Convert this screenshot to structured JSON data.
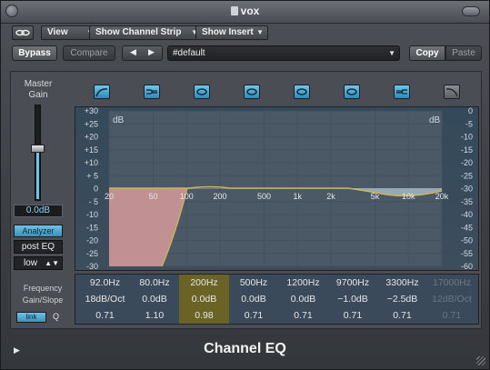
{
  "window": {
    "title": "vox"
  },
  "toolbar": {
    "view_label": "View",
    "channel_strip_label": "Show Channel Strip",
    "insert_label": "Show Insert"
  },
  "preset_bar": {
    "bypass": "Bypass",
    "compare": "Compare",
    "prev": "◀",
    "next": "▶",
    "preset_name": "#default",
    "copy": "Copy",
    "paste": "Paste"
  },
  "master": {
    "label_line1": "Master",
    "label_line2": "Gain",
    "gain_value": "0.0dB",
    "gain_level": 0.54,
    "analyzer": "Analyzer",
    "post_eq": "post EQ",
    "resolution": "low"
  },
  "bands": {
    "icons": [
      {
        "name": "low-cut",
        "active": true
      },
      {
        "name": "low-shelf",
        "active": true
      },
      {
        "name": "bell",
        "active": true
      },
      {
        "name": "bell",
        "active": true
      },
      {
        "name": "bell",
        "active": true
      },
      {
        "name": "bell",
        "active": true
      },
      {
        "name": "high-shelf",
        "active": true
      },
      {
        "name": "high-cut",
        "active": false
      }
    ]
  },
  "graph": {
    "left_unit": "dB",
    "right_unit": "dB",
    "left_scale": [
      "+30",
      "+25",
      "+20",
      "+15",
      "+10",
      "+ 5",
      "0",
      "- 5",
      "-10",
      "-15",
      "-20",
      "-25",
      "-30"
    ],
    "right_scale": [
      "0",
      "-5",
      "-10",
      "-15",
      "-20",
      "-25",
      "-30",
      "-35",
      "-40",
      "-45",
      "-50",
      "-55",
      "-60"
    ],
    "freq_labels": [
      "20",
      "50",
      "100",
      "200",
      "500",
      "1k",
      "2k",
      "5k",
      "10k",
      "20k"
    ],
    "colors": {
      "curve": "#c9b55a",
      "lowcut_fill": "#d59a9a",
      "highshelf_fill": "#9fb2be",
      "grid_bg": "#3a4a5a",
      "highlight": "#6b6326"
    }
  },
  "params": {
    "label_frequency": "Frequency",
    "label_gain_slope": "Gain/Slope",
    "label_q": "Q",
    "link_label": "link",
    "selected_index": 2,
    "columns": [
      {
        "freq": "92.0Hz",
        "gain": "18dB/Oct",
        "q": "0.71",
        "active": true
      },
      {
        "freq": "80.0Hz",
        "gain": "0.0dB",
        "q": "1.10",
        "active": true
      },
      {
        "freq": "200Hz",
        "gain": "0.0dB",
        "q": "0.98",
        "active": true
      },
      {
        "freq": "500Hz",
        "gain": "0.0dB",
        "q": "0.71",
        "active": true
      },
      {
        "freq": "1200Hz",
        "gain": "0.0dB",
        "q": "0.71",
        "active": true
      },
      {
        "freq": "9700Hz",
        "gain": "−1.0dB",
        "q": "0.71",
        "active": true
      },
      {
        "freq": "3300Hz",
        "gain": "−2.5dB",
        "q": "0.71",
        "active": true
      },
      {
        "freq": "17000Hz",
        "gain": "12dB/Oct",
        "q": "0.71",
        "active": false
      }
    ]
  },
  "footer": {
    "title": "Channel EQ"
  }
}
